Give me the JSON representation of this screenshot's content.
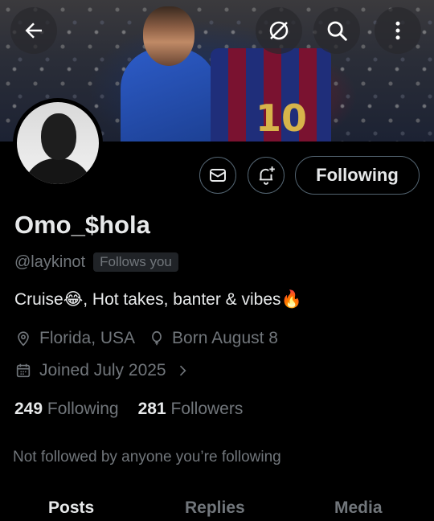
{
  "profile": {
    "display_name": "Omo_$hola",
    "handle": "@laykinot",
    "follows_you": "Follows you",
    "bio_part1": "Cruise",
    "bio_emoji1": "😂",
    "bio_part2": ", Hot takes, banter & vibes",
    "bio_emoji2": "🔥",
    "location": "Florida, USA",
    "birthday": "Born August 8",
    "joined": "Joined July 2025",
    "following_count": "249",
    "following_label": "Following",
    "followers_count": "281",
    "followers_label": "Followers",
    "not_followed": "Not followed by anyone you’re following"
  },
  "banner": {
    "jersey_number": "10"
  },
  "actions": {
    "follow_button": "Following"
  },
  "tabs": [
    {
      "label": "Posts"
    },
    {
      "label": "Replies"
    },
    {
      "label": "Media"
    }
  ],
  "icons": {
    "back": "arrow-left-icon",
    "grok": "grok-icon",
    "search": "search-icon",
    "more": "more-vertical-icon",
    "message": "mail-icon",
    "notify": "bell-plus-icon",
    "location": "location-pin-icon",
    "birthday": "balloon-icon",
    "calendar": "calendar-icon"
  },
  "colors": {
    "background": "#000000",
    "text": "#e7e9ea",
    "secondary": "#71767b",
    "border": "#536471"
  }
}
